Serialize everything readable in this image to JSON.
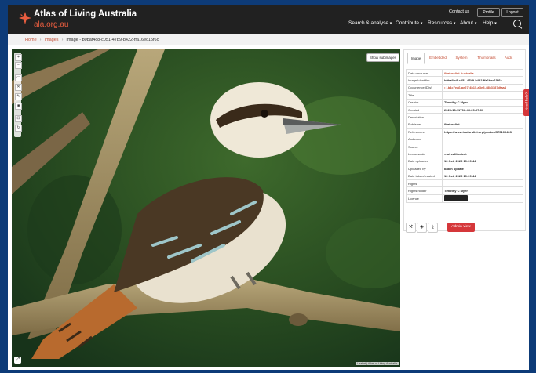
{
  "header": {
    "title": "Atlas of Living Australia",
    "subtitle": "ala.org.au",
    "contact_label": "Contact us",
    "profile_label": "Profile",
    "logout_label": "Logout",
    "nav": [
      {
        "label": "Search & analyse"
      },
      {
        "label": "Contribute"
      },
      {
        "label": "Resources"
      },
      {
        "label": "About"
      },
      {
        "label": "Help"
      }
    ],
    "brand_color": "#e85d3f"
  },
  "breadcrumb": {
    "home": "Home",
    "images": "Images",
    "current": "Image - b0baf4c8-c051-47b9-b422-ffa16ec15f6c"
  },
  "viewer": {
    "show_subimages_label": "Show subimages",
    "zoom_in": "+",
    "zoom_out": "−",
    "attribution": "Leaflet | Atlas of Living Australia"
  },
  "tabs": [
    {
      "label": "Image"
    },
    {
      "label": "Embedded"
    },
    {
      "label": "System"
    },
    {
      "label": "Thumbnails"
    },
    {
      "label": "Audit"
    }
  ],
  "metadata": [
    {
      "key": "Data resource",
      "value": "iNaturalist Australia"
    },
    {
      "key": "Image Identifier",
      "value": "b0baf4c8-c051-47b9-b422-ffa16ec15f6c"
    },
    {
      "key": "Occurrence ID(s)",
      "value": "• 1b4c7ea6-ae27-4b15-a3e5-48b3187dfaa4"
    },
    {
      "key": "Title",
      "value": ""
    },
    {
      "key": "Creator",
      "value": "Timothy C Myer"
    },
    {
      "key": "Created",
      "value": "2025-10-11T06:46:29-07:00"
    },
    {
      "key": "Description",
      "value": ""
    },
    {
      "key": "Publisher",
      "value": "iNaturalist"
    },
    {
      "key": "References",
      "value": "https://www.inaturalist.org/photos/570100403"
    },
    {
      "key": "Audience",
      "value": ""
    },
    {
      "key": "Source",
      "value": ""
    },
    {
      "key": "Linear scale",
      "value": "-not calibrated-"
    },
    {
      "key": "Date uploaded",
      "value": "13 Oct, 2025 19:09:44"
    },
    {
      "key": "Uploaded by",
      "value": "batch update"
    },
    {
      "key": "Date taken/created",
      "value": "13 Oct, 2025 19:09:44"
    },
    {
      "key": "Rights",
      "value": ""
    },
    {
      "key": "Rights holder",
      "value": "Timothy C Myer"
    },
    {
      "key": "Licence",
      "value": ""
    }
  ],
  "actions": {
    "admin_label": "Admin view"
  },
  "help_tab_label": "Need help?"
}
